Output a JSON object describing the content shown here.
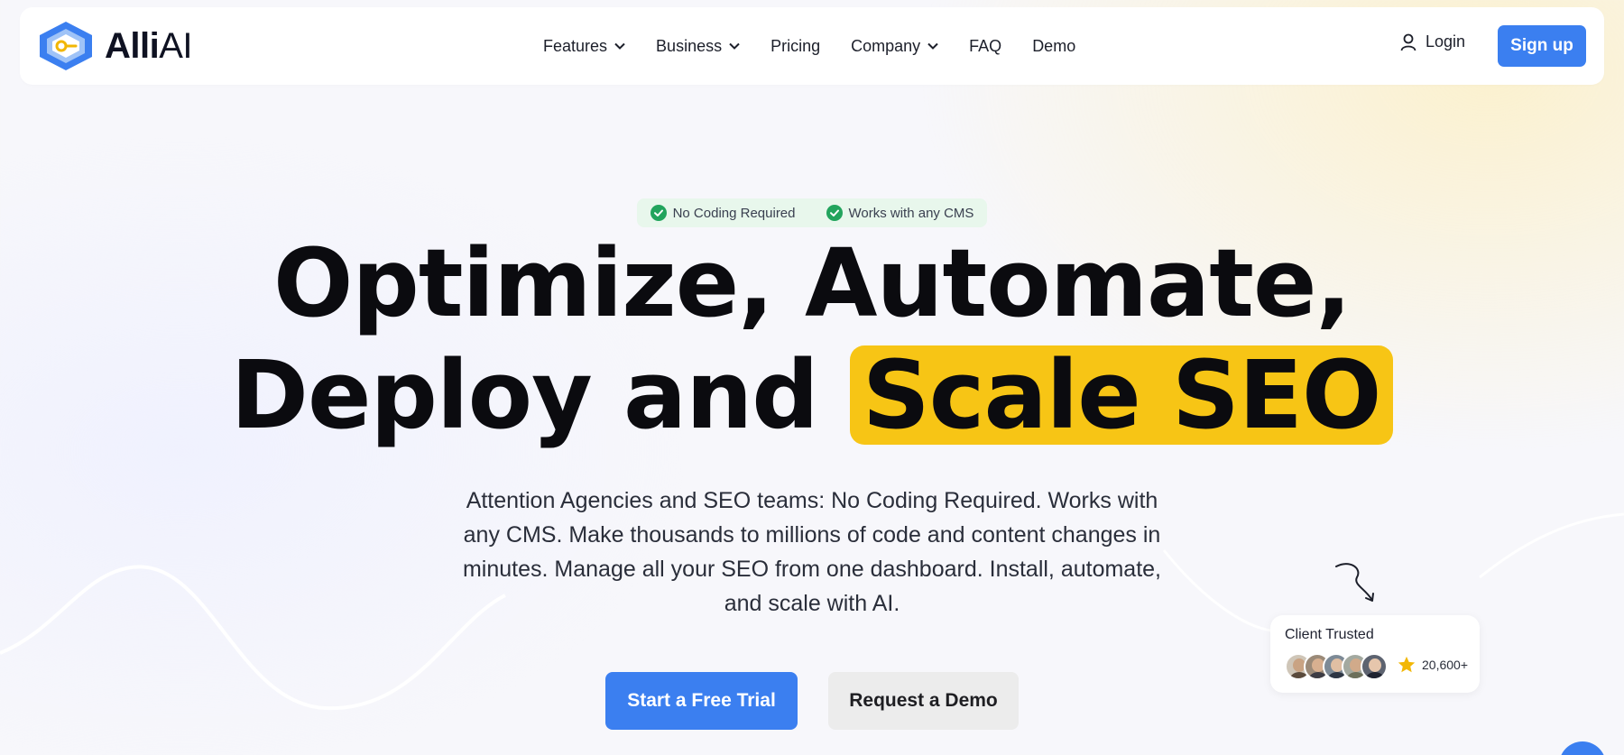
{
  "brand": {
    "name_main": "Alli",
    "name_suffix": "AI",
    "logo_icon": "alli-ai-hexagon-logo"
  },
  "nav": {
    "items": [
      {
        "label": "Features",
        "has_dropdown": true
      },
      {
        "label": "Business",
        "has_dropdown": true
      },
      {
        "label": "Pricing",
        "has_dropdown": false
      },
      {
        "label": "Company",
        "has_dropdown": true
      },
      {
        "label": "FAQ",
        "has_dropdown": false
      },
      {
        "label": "Demo",
        "has_dropdown": false
      }
    ],
    "login_label": "Login",
    "signup_label": "Sign up"
  },
  "hero": {
    "pills": [
      "No Coding Required",
      "Works with any CMS"
    ],
    "headline_line1": "Optimize, Automate,",
    "headline_line2_plain": "Deploy and",
    "headline_line2_highlight": "Scale SEO",
    "subtext": "Attention Agencies and SEO teams: No Coding Required. Works with any CMS. Make thousands to millions of code and content changes in minutes. Manage all your SEO from one dashboard. Install, automate, and scale with AI.",
    "cta_primary": "Start a Free Trial",
    "cta_secondary": "Request a Demo"
  },
  "client_card": {
    "title": "Client Trusted",
    "count": "20,600+",
    "rating_icon": "star-icon"
  },
  "colors": {
    "accent": "#3b7ff0",
    "highlight": "#f7c515",
    "pill_bg": "#e8f7ec",
    "check": "#22a45d"
  }
}
